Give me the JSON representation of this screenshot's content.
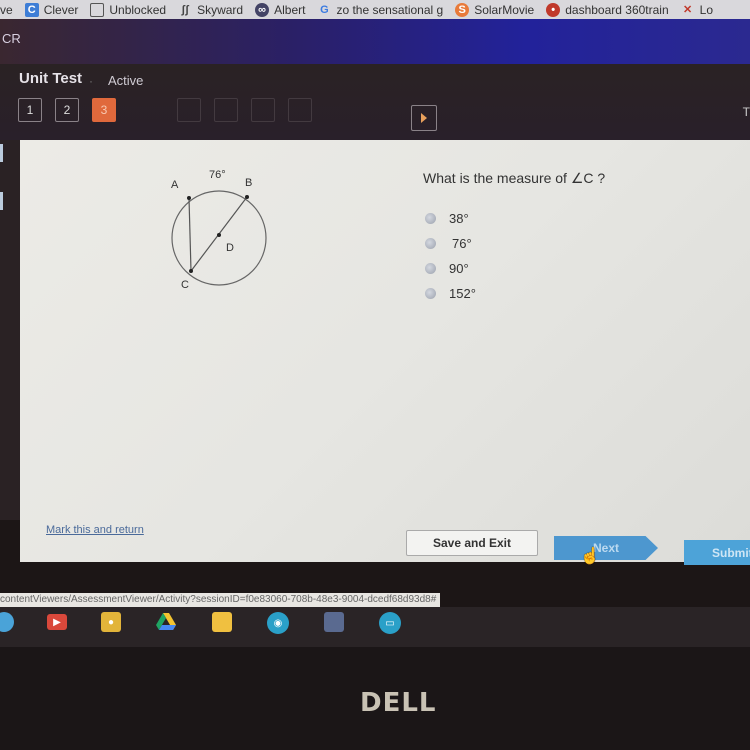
{
  "bookmarks": [
    {
      "label": "ve",
      "icon": "bookmark-partial-icon"
    },
    {
      "label": "Clever",
      "icon": "clever-icon"
    },
    {
      "label": "Unblocked",
      "icon": "window-icon"
    },
    {
      "label": "Skyward",
      "icon": "skyward-icon"
    },
    {
      "label": "Albert",
      "icon": "albert-icon"
    },
    {
      "label": "zo the sensational g",
      "icon": "google-icon"
    },
    {
      "label": "SolarMovie",
      "icon": "solarmovie-icon"
    },
    {
      "label": "dashboard 360train",
      "icon": "dashboard-icon"
    },
    {
      "label": "Lo",
      "icon": "x-logo-icon"
    }
  ],
  "app": {
    "logo": "CR"
  },
  "test": {
    "title": "Unit Test",
    "separator": "·",
    "status": "Active",
    "questions": [
      {
        "label": "1",
        "state": "answered"
      },
      {
        "label": "2",
        "state": "answered"
      },
      {
        "label": "3",
        "state": "current"
      },
      {
        "label": "",
        "state": "locked"
      },
      {
        "label": "",
        "state": "locked"
      },
      {
        "label": "",
        "state": "locked"
      },
      {
        "label": "",
        "state": "locked"
      }
    ],
    "right_text": "T"
  },
  "diagram": {
    "arc_label": "76°",
    "points": [
      "A",
      "B",
      "C",
      "D"
    ]
  },
  "question": {
    "text": "What is the measure of ∠C ?",
    "options": [
      "38°",
      "76°",
      "90°",
      "152°"
    ]
  },
  "footer": {
    "mark_link": "Mark this and return",
    "save_exit": "Save and Exit",
    "next": "Next",
    "submit": "Submit"
  },
  "status_url": "contentViewers/AssessmentViewer/Activity?sessionID=f0e83060-708b-48e3-9004-dcedf68d93d8#",
  "shelf": [
    "chat-icon",
    "youtube-icon",
    "keep-icon",
    "drive-icon",
    "slides-icon",
    "camera-icon",
    "settings-icon",
    "files-icon"
  ],
  "bezel_logo": "DELL",
  "colors": {
    "active_question": "#e0693c",
    "next_button": "#4d97cf",
    "link": "#4a6a9a"
  }
}
